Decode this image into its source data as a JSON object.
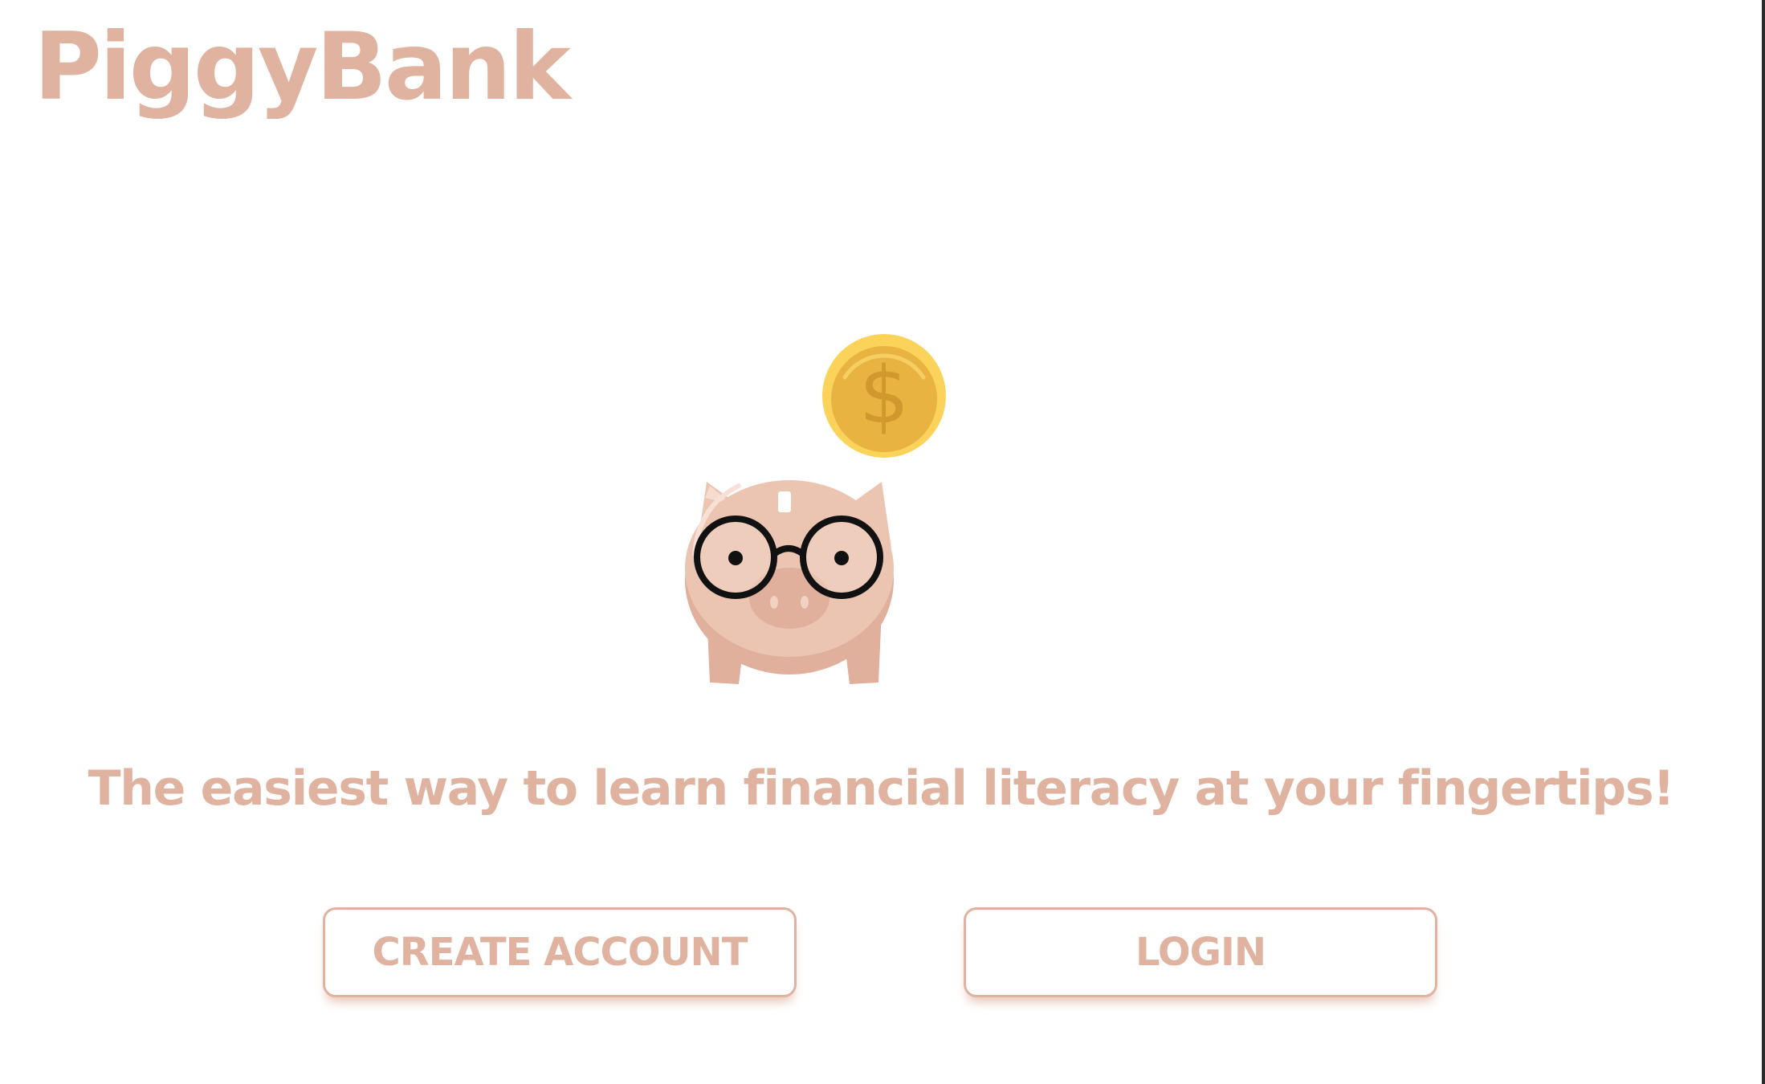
{
  "header": {
    "logo_text": "PiggyBank"
  },
  "hero": {
    "illustration_icon": "piggy-bank-with-glasses-icon",
    "coin_icon": "dollar-coin-icon",
    "coin_symbol": "$"
  },
  "tagline": "The easiest way to learn financial literacy at your fingertips!",
  "actions": {
    "create_account_label": "CREATE ACCOUNT",
    "login_label": "LOGIN"
  },
  "colors": {
    "brand": "#e0b3a0",
    "pig_body": "#ebc5b2",
    "pig_shade": "#e0b09c",
    "coin_outer": "#fbd35a",
    "coin_inner": "#e8b340",
    "coin_symbol": "#d1982e",
    "glasses": "#111111",
    "background": "#ffffff"
  }
}
